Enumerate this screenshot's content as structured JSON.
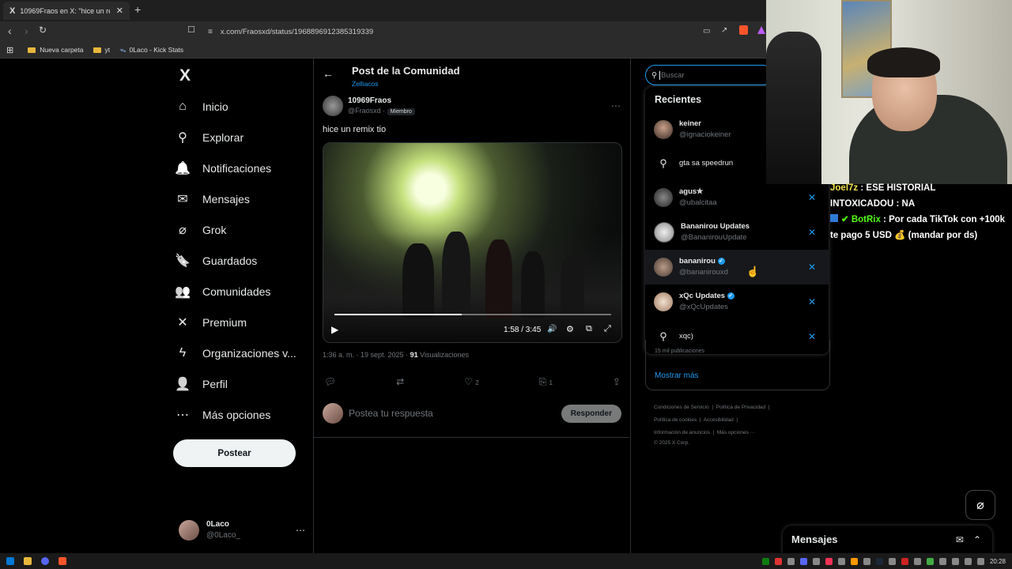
{
  "browser": {
    "tab_title": "10969Fraos en X: \"hice un remix",
    "tab_logo": "X",
    "new_tab": "+",
    "url": "x.com/Fraosxd/status/1968896912385319339",
    "bookmarks": [
      "Nueva carpeta",
      "yt",
      "0Laco - Kick Stats"
    ]
  },
  "nav": {
    "logo": "X",
    "items": [
      {
        "label": "Inicio",
        "icon": "home-icon",
        "glyph": "⌂"
      },
      {
        "label": "Explorar",
        "icon": "search-icon",
        "glyph": "⚲"
      },
      {
        "label": "Notificaciones",
        "icon": "bell-icon",
        "glyph": "🔔"
      },
      {
        "label": "Mensajes",
        "icon": "envelope-icon",
        "glyph": "✉"
      },
      {
        "label": "Grok",
        "icon": "grok-icon",
        "glyph": "⌀"
      },
      {
        "label": "Guardados",
        "icon": "bookmark-icon",
        "glyph": "🔖"
      },
      {
        "label": "Comunidades",
        "icon": "people-icon",
        "glyph": "👥"
      },
      {
        "label": "Premium",
        "icon": "x-premium-icon",
        "glyph": "✕"
      },
      {
        "label": "Organizaciones v...",
        "icon": "lightning-icon",
        "glyph": "ϟ"
      },
      {
        "label": "Perfil",
        "icon": "person-icon",
        "glyph": "👤"
      },
      {
        "label": "Más opciones",
        "icon": "more-circle-icon",
        "glyph": "⋯"
      }
    ],
    "post_label": "Postear",
    "account_name": "0Laco",
    "account_handle": "@0Laco_",
    "account_more": "⋯"
  },
  "post": {
    "header_title": "Post de la Comunidad",
    "community": "Zelliacos",
    "author_name": "10969Fraos",
    "author_handle": "@Fraosxd",
    "author_badge": "Miembro",
    "more": "⋯",
    "text": "hice un remix tio",
    "video_time": "1:58 / 3:45",
    "video_progress": 0.46,
    "meta_time": "1:36 a. m. · 19 sept. 2025 ·",
    "views_count": "91",
    "views_label": "Visualizaciones",
    "likes": "2",
    "bookmarks": "1",
    "reply_placeholder": "Postea tu respuesta",
    "reply_button": "Responder"
  },
  "search": {
    "placeholder": "Buscar",
    "recent_title": "Recientes",
    "items": [
      {
        "type": "user",
        "name": "keiner",
        "handle": "@ignaciokeiner",
        "verified": false,
        "removable": false
      },
      {
        "type": "query",
        "name": "gta sa speedrun",
        "removable": false
      },
      {
        "type": "user",
        "name": "agus✮",
        "handle": "@ubalcitaa",
        "verified": false,
        "removable": true
      },
      {
        "type": "user",
        "name": "Bananirou Updates",
        "handle": "@BananirouUpdate",
        "verified": false,
        "removable": true
      },
      {
        "type": "user",
        "name": "bananirou",
        "handle": "@bananirouxd",
        "verified": true,
        "removable": true
      },
      {
        "type": "user",
        "name": "xQc Updates",
        "handle": "@xQcUpdates",
        "verified": true,
        "removable": true
      },
      {
        "type": "query",
        "name": "xqc)",
        "removable": true
      }
    ],
    "remove_glyph": "✕",
    "partial_trend": "15 mil publicaciones",
    "show_more": "Mostrar más"
  },
  "footer": {
    "links": [
      "Condiciones de Servicio",
      "Política de Privacidad",
      "Política de cookies",
      "Accesibilidad",
      "Información de anuncios",
      "Más opciones ···"
    ],
    "copyright": "© 2025 X Corp."
  },
  "chat": [
    {
      "user": "Joel7z",
      "msg": "ESE HISTORIAL",
      "color": "#f2e24c"
    },
    {
      "user": "INTOXICADOU",
      "msg": "NA",
      "color": "#ffffff"
    },
    {
      "user": "BotRix",
      "msg": "Por cada TikTok con +100k te pago 5 USD 💰 (mandar por ds)",
      "color": "#53fc18"
    }
  ],
  "messages_drawer": {
    "title": "Mensajes"
  },
  "taskbar": {
    "clock": "20:28"
  },
  "colors": {
    "accent": "#1d9bf0",
    "border": "#2f3336",
    "muted": "#71767b"
  }
}
